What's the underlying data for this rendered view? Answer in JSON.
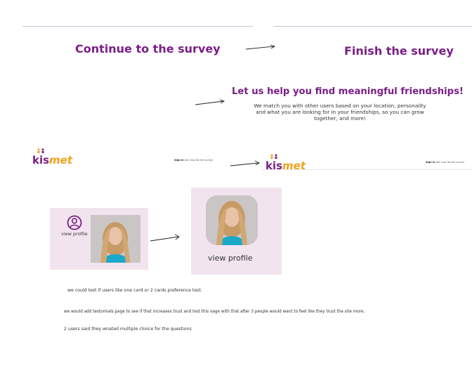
{
  "steps": {
    "continue_label": "Continue to the survey",
    "finish_label": "Finish the survey"
  },
  "headline": {
    "title": "Let us help you find meaningful friendships!",
    "body_line1": "We match you with other users based on your location, personality",
    "body_line2": "and what you are looking for in your friendships, so you can grow",
    "body_line3": "together, and more!"
  },
  "navbar_old": {
    "logo_k": "kis",
    "logo_met": "met",
    "link_signin": "Sign in",
    "link_join": "Join now",
    "link_survey": "Do the survey"
  },
  "navbar_new": {
    "logo_k": "kis",
    "logo_met": "met",
    "link_signin": "Sign in",
    "link_join": "Join now",
    "link_survey": "Do the survey"
  },
  "cards": {
    "old_label": "view profile",
    "new_label": "view profile"
  },
  "notes": {
    "note1": "we could test if users like one card or 2 cards preference test.",
    "note2": "we would add testomials page to see if that increases trust and test this oage with that after 3 people would want to feel like they trust the site more.",
    "note3": "2 users  said they wnated multiple choice for the questions"
  },
  "colors": {
    "brand_purple": "#7a1f86",
    "brand_orange": "#f2a21a",
    "card_bg": "#f2e4ef"
  }
}
